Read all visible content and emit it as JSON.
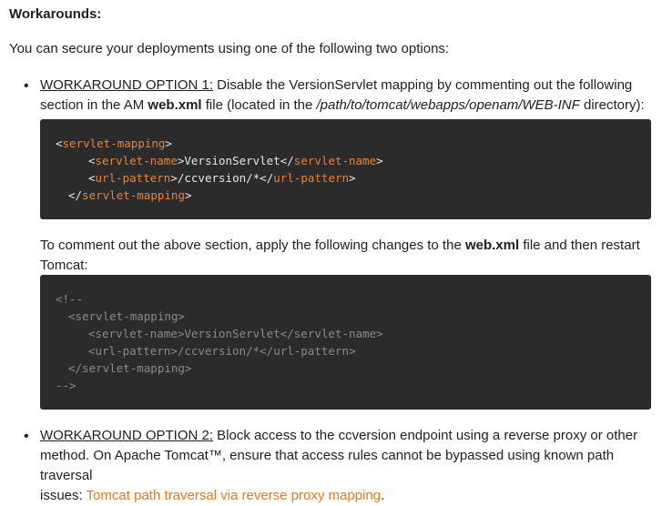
{
  "heading": "Workarounds:",
  "intro": "You can secure your deployments using one of the following two options:",
  "option1": {
    "label": "WORKAROUND OPTION 1:",
    "text_a": " Disable the VersionServlet mapping by commenting out the following",
    "text_b": "section in the AM ",
    "file": "web.xml",
    "text_c": " file (located in the ",
    "path": "/path/to/tomcat/webapps/openam/WEB-INF",
    "text_d": " directory):"
  },
  "code1": {
    "lt": "<",
    "gt": ">",
    "close_lt": "</",
    "servlet_mapping": "servlet-mapping",
    "servlet_name": "servlet-name",
    "servlet_value": "VersionServlet",
    "url_pattern": "url-pattern",
    "url_value": "/ccversion/*"
  },
  "between": {
    "text_a": "To comment out the above section, apply the following changes to the ",
    "file": "web.xml",
    "text_b": " file and then restart",
    "text_c": "Tomcat:"
  },
  "code2": {
    "open": "<!--",
    "line1": "<servlet-mapping>",
    "line2": "<servlet-name>VersionServlet</servlet-name>",
    "line3": "<url-pattern>/ccversion/*</url-pattern>",
    "line4": "</servlet-mapping>",
    "close": "-->"
  },
  "option2": {
    "label": "WORKAROUND OPTION 2:",
    "text_a": " Block access to the ccversion endpoint using a reverse proxy or other",
    "text_b": "method. On Apache Tomcat™, ensure that access rules cannot be bypassed using known path traversal",
    "text_c": "issues: ",
    "link": "Tomcat path traversal via reverse proxy mapping",
    "text_d": "."
  },
  "bullet": "•",
  "colors": {
    "code_bg": "#2b2b2b",
    "tag": "#e8833a",
    "link": "#e07b1f",
    "comment": "#8a8a8a"
  }
}
